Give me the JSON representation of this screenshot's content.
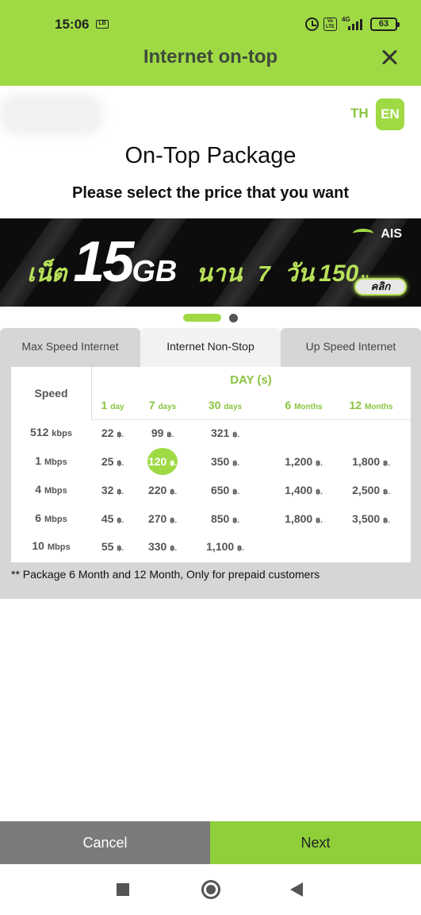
{
  "status_bar": {
    "time": "15:06",
    "network_type": "4G",
    "battery": "63"
  },
  "header": {
    "title": "Internet on-top"
  },
  "language": {
    "th": "TH",
    "en": "EN",
    "selected": "EN"
  },
  "page": {
    "title": "On-Top Package",
    "subtitle": "Please select the price that you want"
  },
  "banner": {
    "prefix": "เน็ต",
    "amount": "15",
    "unit": "GB",
    "duration_word": "นาน",
    "duration_value": "7",
    "duration_unit": "วัน",
    "price": "150",
    "currency": "บ.",
    "brand": "AIS",
    "cta": "คลิก"
  },
  "carousel": {
    "active_index": 0,
    "count": 2
  },
  "tabs": [
    {
      "label": "Max Speed Internet",
      "active": false
    },
    {
      "label": "Internet Non-Stop",
      "active": true
    },
    {
      "label": "Up Speed Internet",
      "active": false
    }
  ],
  "table": {
    "speed_header": "Speed",
    "day_header": "DAY (s)",
    "durations": [
      {
        "value": "1",
        "unit": "day"
      },
      {
        "value": "7",
        "unit": "days"
      },
      {
        "value": "30",
        "unit": "days"
      },
      {
        "value": "6",
        "unit": "Months"
      },
      {
        "value": "12",
        "unit": "Months"
      }
    ],
    "currency": "฿.",
    "rows": [
      {
        "speed": "512",
        "unit": "kbps",
        "prices": [
          "22",
          "99",
          "321",
          "",
          ""
        ]
      },
      {
        "speed": "1",
        "unit": "Mbps",
        "prices": [
          "25",
          "120",
          "350",
          "1,200",
          "1,800"
        ]
      },
      {
        "speed": "4",
        "unit": "Mbps",
        "prices": [
          "32",
          "220",
          "650",
          "1,400",
          "2,500"
        ]
      },
      {
        "speed": "6",
        "unit": "Mbps",
        "prices": [
          "45",
          "270",
          "850",
          "1,800",
          "3,500"
        ]
      },
      {
        "speed": "10",
        "unit": "Mbps",
        "prices": [
          "55",
          "330",
          "1,100",
          "",
          ""
        ]
      }
    ],
    "selected": {
      "row": 1,
      "col": 1
    },
    "note": "** Package 6 Month and 12 Month, Only for prepaid customers"
  },
  "actions": {
    "cancel": "Cancel",
    "next": "Next"
  },
  "colors": {
    "accent": "#9fda45",
    "accent_text": "#8ac440",
    "cancel_bg": "#7b7b7b",
    "next_bg": "#8fd03a"
  }
}
